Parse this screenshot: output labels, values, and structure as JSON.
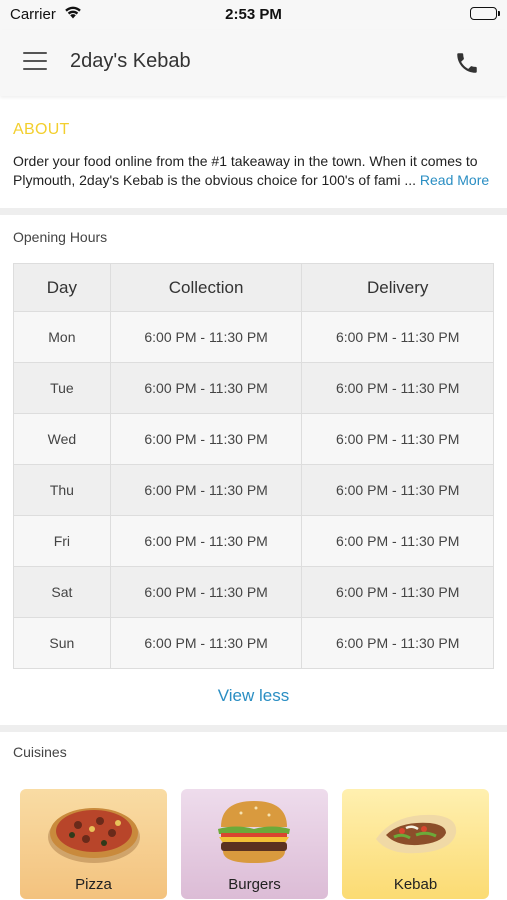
{
  "status_bar": {
    "carrier": "Carrier",
    "time": "2:53 PM"
  },
  "nav": {
    "title": "2day's Kebab",
    "menu_icon": "hamburger-menu-icon",
    "phone_icon": "phone-icon"
  },
  "about": {
    "heading": "ABOUT",
    "text": "Order your food online from the #1 takeaway in the town. When it comes to Plymouth, 2day's Kebab is the obvious choice for 100's of fami ...",
    "read_more": "Read More"
  },
  "hours": {
    "heading": "Opening Hours",
    "columns": [
      "Day",
      "Collection",
      "Delivery"
    ],
    "rows": [
      {
        "day": "Mon",
        "collection": "6:00 PM - 11:30 PM",
        "delivery": "6:00 PM - 11:30 PM"
      },
      {
        "day": "Tue",
        "collection": "6:00 PM - 11:30 PM",
        "delivery": "6:00 PM - 11:30 PM"
      },
      {
        "day": "Wed",
        "collection": "6:00 PM - 11:30 PM",
        "delivery": "6:00 PM - 11:30 PM"
      },
      {
        "day": "Thu",
        "collection": "6:00 PM - 11:30 PM",
        "delivery": "6:00 PM - 11:30 PM"
      },
      {
        "day": "Fri",
        "collection": "6:00 PM - 11:30 PM",
        "delivery": "6:00 PM - 11:30 PM"
      },
      {
        "day": "Sat",
        "collection": "6:00 PM - 11:30 PM",
        "delivery": "6:00 PM - 11:30 PM"
      },
      {
        "day": "Sun",
        "collection": "6:00 PM - 11:30 PM",
        "delivery": "6:00 PM - 11:30 PM"
      }
    ],
    "view_less": "View less"
  },
  "cuisines": {
    "heading": "Cuisines",
    "items": [
      {
        "label": "Pizza",
        "icon": "pizza-icon"
      },
      {
        "label": "Burgers",
        "icon": "burger-icon"
      },
      {
        "label": "Kebab",
        "icon": "kebab-icon"
      }
    ]
  },
  "colors": {
    "accent": "#f3cf2e",
    "link": "#2a8ec3",
    "section_gap": "#eeeeee"
  }
}
